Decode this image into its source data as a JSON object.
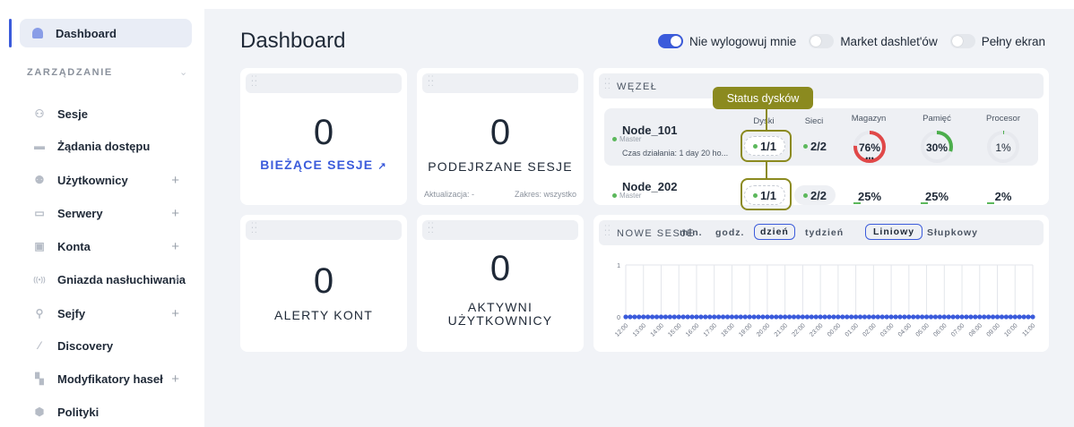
{
  "sidebar": {
    "active": "Dashboard",
    "section": "ZARZĄDZANIE",
    "items": [
      {
        "label": "Sesje",
        "icon": "sessions-icon",
        "plus": ""
      },
      {
        "label": "Żądania dostępu",
        "icon": "access-requests-icon",
        "plus": ""
      },
      {
        "label": "Użytkownicy",
        "icon": "users-icon",
        "plus": "+"
      },
      {
        "label": "Serwery",
        "icon": "servers-icon",
        "plus": "+"
      },
      {
        "label": "Konta",
        "icon": "accounts-icon",
        "plus": "+"
      },
      {
        "label": "Gniazda nasłuchiwania",
        "icon": "listeners-icon",
        "plus": "+"
      },
      {
        "label": "Sejfy",
        "icon": "safes-icon",
        "plus": "+"
      },
      {
        "label": "Discovery",
        "icon": "discovery-icon",
        "plus": ""
      },
      {
        "label": "Modyfikatory haseł",
        "icon": "password-changers-icon",
        "plus": "+"
      },
      {
        "label": "Polityki",
        "icon": "policies-icon",
        "plus": ""
      }
    ]
  },
  "header": {
    "title": "Dashboard",
    "toggles": [
      {
        "label": "Nie wylogowuj mnie",
        "on": true
      },
      {
        "label": "Market dashlet'ów",
        "on": false
      },
      {
        "label": "Pełny ekran",
        "on": false
      }
    ]
  },
  "widgets": {
    "current_sessions": {
      "value": "0",
      "label": "BIEŻĄCE SESJE"
    },
    "suspicious_sessions": {
      "value": "0",
      "label": "PODEJRZANE SESJE",
      "update": "Aktualizacja: -",
      "range": "Zakres: wszystko"
    },
    "account_alerts": {
      "value": "0",
      "label": "ALERTY KONT"
    },
    "active_users": {
      "value": "0",
      "label_line1": "AKTYWNI",
      "label_line2": "UŻYTKOWNICY"
    }
  },
  "node_widget": {
    "title": "WĘZEŁ",
    "tooltip": "Status dysków",
    "columns": [
      "Dyski",
      "Sieci",
      "Magazyn",
      "Pamięć",
      "Procesor"
    ],
    "nodes": [
      {
        "name": "Node_101",
        "role": "Master",
        "uptime": "Czas działania: 1 day 20 ho...",
        "disks": "1/1",
        "networks": "2/2",
        "storage": "76%",
        "storage_value": 76,
        "memory": "30%",
        "memory_value": 30,
        "cpu": "1%",
        "cpu_value": 1
      },
      {
        "name": "Node_202",
        "role": "Master",
        "disks": "1/1",
        "networks": "2/2",
        "storage": "25%",
        "memory": "25%",
        "cpu": "2%"
      }
    ]
  },
  "sessions_widget": {
    "title": "NOWE SESJE",
    "range_options": [
      "min.",
      "godz.",
      "dzień",
      "tydzień"
    ],
    "range_selected": "dzień",
    "chart_types": [
      "Liniowy",
      "Słupkowy"
    ],
    "chart_selected": "Liniowy"
  },
  "chart_data": {
    "type": "line",
    "x": [
      "12:00",
      "13:00",
      "14:00",
      "15:00",
      "16:00",
      "17:00",
      "18:00",
      "19:00",
      "20:00",
      "21:00",
      "22:00",
      "23:00",
      "00:00",
      "01:00",
      "02:00",
      "03:00",
      "04:00",
      "05:00",
      "06:00",
      "07:00",
      "08:00",
      "09:00",
      "10:00",
      "11:00"
    ],
    "y_ticks": [
      "1",
      "0"
    ],
    "ylim": [
      0,
      1
    ],
    "series": [
      {
        "values": [
          0,
          0,
          0,
          0,
          0,
          0,
          0,
          0,
          0,
          0,
          0,
          0,
          0,
          0,
          0,
          0,
          0,
          0,
          0,
          0,
          0,
          0,
          0,
          0
        ]
      }
    ],
    "color": "#3b5bdb",
    "grid": true
  }
}
